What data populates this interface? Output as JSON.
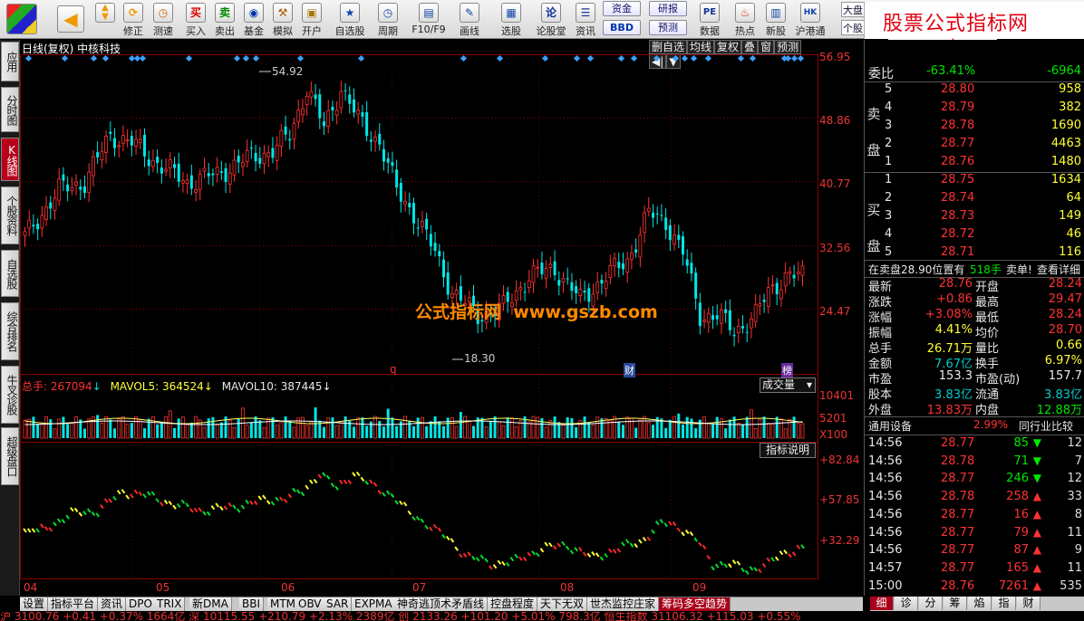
{
  "toolbar": {
    "buttons": [
      {
        "label": "",
        "icon": "grid-icon"
      },
      {
        "label": "",
        "icon": "back-arrow-icon"
      },
      {
        "label": "",
        "icon": "updown-icon"
      },
      {
        "label": "修正",
        "icon": "refresh-icon"
      },
      {
        "label": "测速",
        "icon": "clock-icon"
      },
      {
        "label": "买入",
        "icon": "buy-icon",
        "glyph": "买"
      },
      {
        "label": "卖出",
        "icon": "sell-icon",
        "glyph": "卖"
      },
      {
        "label": "基金",
        "icon": "fund-icon"
      },
      {
        "label": "模拟",
        "icon": "hammer-icon"
      },
      {
        "label": "开户",
        "icon": "lock-icon"
      },
      {
        "label": "自选股",
        "icon": "star-icon"
      },
      {
        "label": "周期",
        "icon": "clock-icon"
      },
      {
        "label": "F10/F9",
        "icon": "window-icon"
      },
      {
        "label": "画线",
        "icon": "pen-icon"
      },
      {
        "label": "选股",
        "icon": "screen-icon"
      },
      {
        "label": "论股堂",
        "icon": "chat-icon",
        "glyph": "论"
      },
      {
        "label": "资讯",
        "icon": "news-icon"
      },
      {
        "label": "数据",
        "icon": "pe-icon",
        "glyph": "PE"
      },
      {
        "label": "热点",
        "icon": "hot-icon"
      },
      {
        "label": "新股",
        "icon": "newstock-icon"
      },
      {
        "label": "沪港通",
        "icon": "hk-icon"
      },
      {
        "label": "个股",
        "icon": "dropdown-icon"
      }
    ],
    "small_buttons": [
      "资金",
      "研报",
      "BBD",
      "预测"
    ],
    "market_label": "大盘"
  },
  "brand": {
    "line1": "股票公式指标网",
    "line2": "www.gszb.com"
  },
  "left_tabs": [
    "应用",
    "分时图",
    "K线图",
    "个股资料",
    "自选股",
    "综合排名",
    "牛叉诊股",
    "超级盘口"
  ],
  "chart": {
    "title": "日线(复权)  中核科技",
    "tools": [
      "删自选",
      "均线",
      "复权",
      "叠",
      "窗",
      "预测",
      "◀|",
      "▼"
    ],
    "price_axis": [
      "56.95",
      "48.86",
      "40.77",
      "32.56",
      "24.47"
    ],
    "high_label": "54.92",
    "low_label": "18.30",
    "watermark": "公式指标网  www.gszb.com",
    "markers": [
      "q",
      "财",
      "榜"
    ],
    "volume_header": {
      "total_label": "总手: 267094",
      "ma5_label": "MAVOL5: 364524",
      "ma10_label": "MAVOL10: 387445"
    },
    "volume_axis": [
      "10401",
      "5201",
      "X100"
    ],
    "volume_selector": "成交量",
    "indicator_button": "指标说明",
    "indicator_axis": [
      "+82.84",
      "+57.85",
      "+32.29"
    ],
    "month_labels": [
      "04",
      "05",
      "06",
      "07",
      "08",
      "09"
    ]
  },
  "chart_data": {
    "type": "candlestick",
    "title": "日线(复权) 中核科技",
    "ylim": [
      18.3,
      56.95
    ],
    "high": 54.92,
    "low": 18.3,
    "last_close": 28.76
  },
  "bottom_tabs": [
    "设置",
    "指标平台",
    "资讯",
    "DPO",
    "TRIX",
    "新DMA",
    "BBI",
    "MTM",
    "OBV",
    "SAR",
    "EXPMA",
    "神奇逃顶术矛盾线",
    "控盘程度",
    "天下无双",
    "世杰监控庄家",
    "筹码多空趋势"
  ],
  "right_tabs": [
    "细",
    "诊",
    "分",
    "筹",
    "焰",
    "指",
    "财"
  ],
  "ticker": "沪 3100.76  +0.41  +0.37%   1664亿 深 10115.55  +210.79  +2.13%   2389亿 创 2133.26  +101.20  +5.01%   798.3亿 恒生指数  31106.32  +115.03  +0.55%",
  "quote": {
    "wei_bi_label": "委比",
    "wei_bi": "-63.41%",
    "wei_cha": "-6964",
    "sell_label": "卖盘",
    "buy_label": "买盘",
    "sells": [
      {
        "n": "5",
        "price": "28.80",
        "vol": "958"
      },
      {
        "n": "4",
        "price": "28.79",
        "vol": "382"
      },
      {
        "n": "3",
        "price": "28.78",
        "vol": "1690"
      },
      {
        "n": "2",
        "price": "28.77",
        "vol": "4463"
      },
      {
        "n": "1",
        "price": "28.76",
        "vol": "1480"
      }
    ],
    "buys": [
      {
        "n": "1",
        "price": "28.75",
        "vol": "1634"
      },
      {
        "n": "2",
        "price": "28.74",
        "vol": "64"
      },
      {
        "n": "3",
        "price": "28.73",
        "vol": "149"
      },
      {
        "n": "4",
        "price": "28.72",
        "vol": "46"
      },
      {
        "n": "5",
        "price": "28.71",
        "vol": "116"
      }
    ],
    "notice_a": "在卖盘28.90位置有",
    "notice_b": "518手",
    "notice_c": "卖单!",
    "notice_d": "查看详细",
    "stats": [
      {
        "l1": "最新",
        "v1": "28.76",
        "c1": "red",
        "l2": "开盘",
        "v2": "28.24",
        "c2": "red"
      },
      {
        "l1": "涨跌",
        "v1": "+0.86",
        "c1": "red",
        "l2": "最高",
        "v2": "29.47",
        "c2": "red"
      },
      {
        "l1": "涨幅",
        "v1": "+3.08%",
        "c1": "red",
        "l2": "最低",
        "v2": "28.24",
        "c2": "red"
      },
      {
        "l1": "振幅",
        "v1": "4.41%",
        "c1": "yellow",
        "l2": "均价",
        "v2": "28.70",
        "c2": "red"
      },
      {
        "l1": "总手",
        "v1": "26.71万",
        "c1": "yellow",
        "l2": "量比",
        "v2": "0.66",
        "c2": "yellow"
      },
      {
        "l1": "金额",
        "v1": "7.67亿",
        "c1": "cyan",
        "l2": "换手",
        "v2": "6.97%",
        "c2": "yellow"
      },
      {
        "l1": "市盈",
        "v1": "153.3",
        "c1": "white",
        "l2": "市盈(动)",
        "v2": "157.7",
        "c2": "white"
      },
      {
        "l1": "股本",
        "v1": "3.83亿",
        "c1": "cyan",
        "l2": "流通",
        "v2": "3.83亿",
        "c2": "cyan"
      },
      {
        "l1": "外盘",
        "v1": "13.83万",
        "c1": "red",
        "l2": "内盘",
        "v2": "12.88万",
        "c2": "green"
      }
    ],
    "industry": "通用设备",
    "industry_pct": "2.99%",
    "industry_btn": "同行业比较",
    "ticks": [
      {
        "t": "14:56",
        "p": "28.77",
        "v": "85",
        "d": "down",
        "n": "12"
      },
      {
        "t": "14:56",
        "p": "28.78",
        "v": "71",
        "d": "down",
        "n": "7"
      },
      {
        "t": "14:56",
        "p": "28.77",
        "v": "246",
        "d": "down",
        "n": "12"
      },
      {
        "t": "14:56",
        "p": "28.78",
        "v": "258",
        "d": "up",
        "n": "33"
      },
      {
        "t": "14:56",
        "p": "28.77",
        "v": "16",
        "d": "up",
        "n": "8"
      },
      {
        "t": "14:56",
        "p": "28.77",
        "v": "79",
        "d": "up",
        "n": "11"
      },
      {
        "t": "14:56",
        "p": "28.77",
        "v": "87",
        "d": "up",
        "n": "9"
      },
      {
        "t": "14:57",
        "p": "28.77",
        "v": "165",
        "d": "up",
        "n": "11"
      },
      {
        "t": "15:00",
        "p": "28.76",
        "v": "7261",
        "d": "up",
        "n": "535"
      }
    ]
  },
  "colors": {
    "up": "#ff3232",
    "down": "#00e6e6",
    "grid": "#8a0000",
    "bg": "#000000"
  }
}
